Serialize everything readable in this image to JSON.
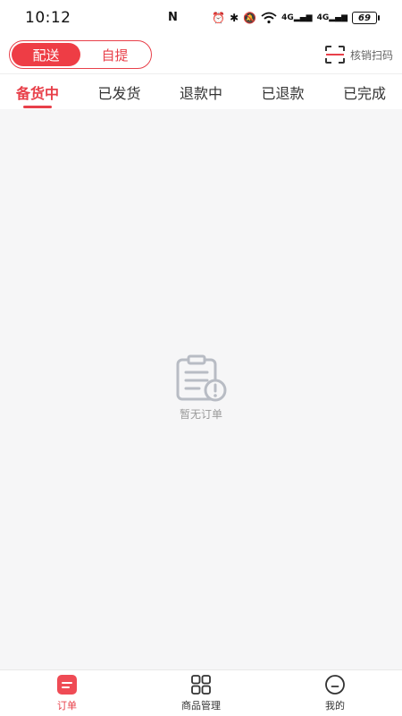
{
  "status_bar": {
    "time": "10:12",
    "nfc": "N",
    "signal_1": "4G",
    "signal_2": "4G",
    "battery": "69"
  },
  "mode_switch": {
    "options": [
      "配送",
      "自提"
    ],
    "active_index": 0
  },
  "scan": {
    "label": "核销扫码"
  },
  "tabs": {
    "items": [
      "备货中",
      "已发货",
      "退款中",
      "已退款",
      "已完成"
    ],
    "active_index": 0
  },
  "empty_state": {
    "text": "暂无订单"
  },
  "bottom_nav": {
    "items": [
      {
        "label": "订单",
        "icon": "order-icon"
      },
      {
        "label": "商品管理",
        "icon": "grid-icon"
      },
      {
        "label": "我的",
        "icon": "profile-icon"
      }
    ],
    "active_index": 0
  },
  "colors": {
    "accent": "#e8404a",
    "background": "#f6f6f7",
    "muted_text": "#9a9a9a"
  }
}
